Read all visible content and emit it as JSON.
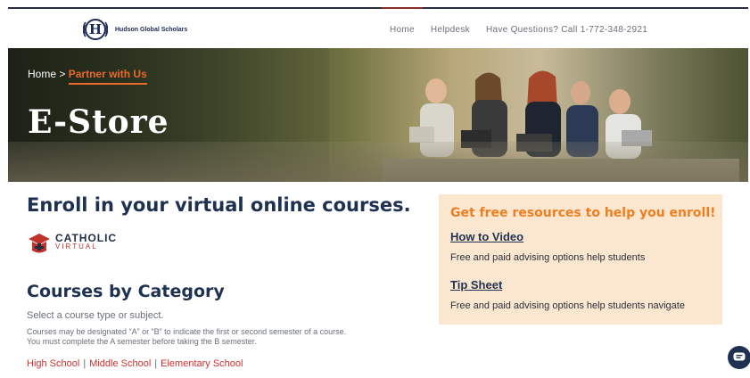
{
  "header": {
    "logo_text": "Hudson Global Scholars",
    "logo_letter": "H",
    "nav": [
      {
        "label": "Home"
      },
      {
        "label": "Helpdesk"
      },
      {
        "label": "Have Questions? Call 1-772-348-2921"
      }
    ]
  },
  "hero": {
    "breadcrumb_home": "Home",
    "breadcrumb_sep": ">",
    "breadcrumb_current": "Partner with Us",
    "title": "E-Store"
  },
  "main": {
    "enroll_title": "Enroll in your virtual online courses.",
    "catholic_logo_line1": "CATHOLIC",
    "catholic_logo_line2": "VIRTUAL",
    "courses_title": "Courses by Category",
    "courses_subtitle": "Select a course type or subject.",
    "courses_note_1": "Courses may be designated “A” or “B” to indicate the first or second semester of a course.",
    "courses_note_2": "You must complete the A semester before taking the B semester.",
    "level_links": [
      {
        "label": "High School"
      },
      {
        "label": "Middle School"
      },
      {
        "label": "Elementary School"
      }
    ],
    "level_separator": "|"
  },
  "resources": {
    "title": "Get free resources to help you enroll!",
    "items": [
      {
        "link": "How to Video",
        "description": "Free and paid advising options help students"
      },
      {
        "link": "Tip Sheet",
        "description": "Free and paid advising options help students navigate"
      }
    ]
  },
  "chat": {
    "icon": "chat-icon"
  },
  "colors": {
    "navy": "#1f3150",
    "orange": "#f07e1f",
    "red_link": "#d0312d",
    "resource_bg": "#fbe7d0"
  }
}
